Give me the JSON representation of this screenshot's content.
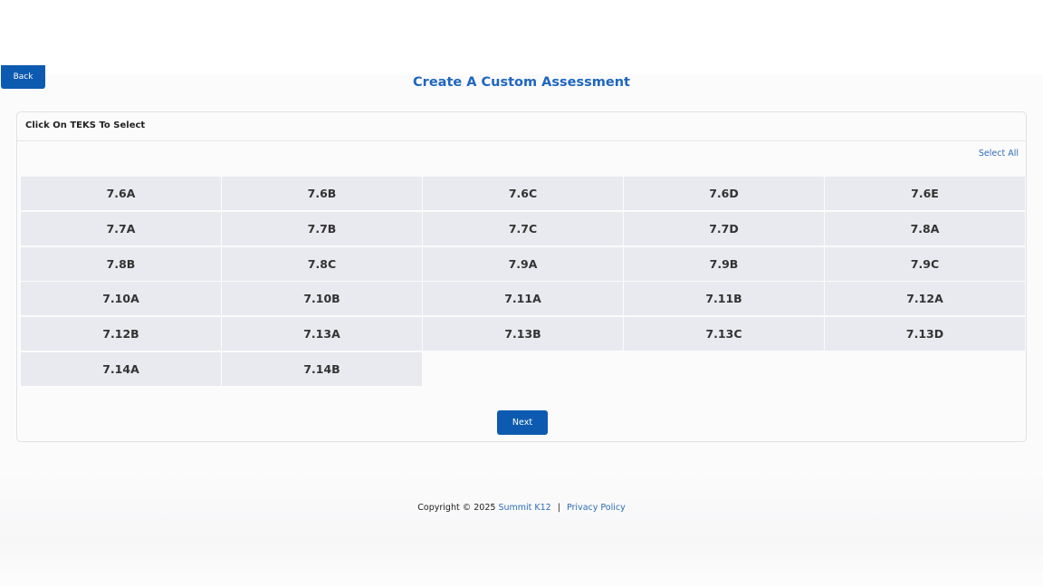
{
  "header": {
    "back_label": "Back",
    "title": "Create A Custom Assessment"
  },
  "card": {
    "header_label": "Click On TEKS To Select",
    "select_all_label": "Select All",
    "teks": [
      "7.6A",
      "7.6B",
      "7.6C",
      "7.6D",
      "7.6E",
      "7.7A",
      "7.7B",
      "7.7C",
      "7.7D",
      "7.8A",
      "7.8B",
      "7.8C",
      "7.9A",
      "7.9B",
      "7.9C",
      "7.10A",
      "7.10B",
      "7.11A",
      "7.11B",
      "7.12A",
      "7.12B",
      "7.13A",
      "7.13B",
      "7.13C",
      "7.13D",
      "7.14A",
      "7.14B"
    ],
    "next_label": "Next"
  },
  "footer": {
    "copyright": "Copyright © 2025",
    "brand_link": "Summit K12",
    "separator": "|",
    "privacy_link": "Privacy Policy"
  },
  "colors": {
    "primary_button": "#0d5bb0",
    "title": "#1f66bf",
    "link": "#2f6db5",
    "cell_bg": "#e9eaef"
  }
}
